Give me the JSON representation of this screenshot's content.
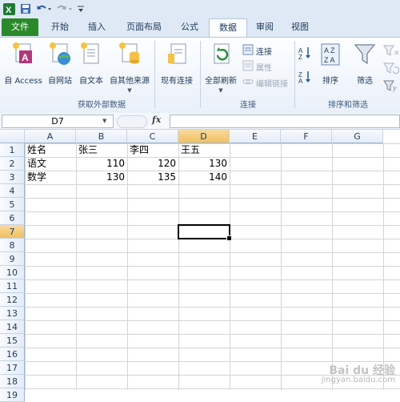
{
  "quick_access": {
    "app_icon": "excel-icon",
    "save_icon": "save-icon",
    "undo_icon": "undo-icon",
    "redo_icon": "redo-icon",
    "customize_icon": "customize-icon"
  },
  "tabs": [
    "文件",
    "开始",
    "插入",
    "页面布局",
    "公式",
    "数据",
    "审阅",
    "视图"
  ],
  "active_tab": "数据",
  "ribbon": {
    "get_external_data": {
      "label": "获取外部数据",
      "buttons": [
        "自 Access",
        "自网站",
        "自文本",
        "自其他来源"
      ]
    },
    "existing_connections": "现有连接",
    "connections": {
      "label": "连接",
      "refresh_all": "全部刷新",
      "connections": "连接",
      "properties": "属性",
      "edit_links": "编辑链接"
    },
    "sort_filter": {
      "label": "排序和筛选",
      "sort": "排序",
      "filter": "筛选"
    }
  },
  "formula_bar": {
    "name_box": "D7",
    "fx": "fx",
    "value": ""
  },
  "sheet": {
    "columns": [
      "A",
      "B",
      "C",
      "D",
      "E",
      "F",
      "G"
    ],
    "selected_column": "D",
    "rows": [
      "1",
      "2",
      "3",
      "4",
      "5",
      "6",
      "7",
      "8",
      "9",
      "10",
      "11",
      "12",
      "13",
      "14",
      "15",
      "16",
      "17",
      "18",
      "19"
    ],
    "selected_row": "7",
    "cells": {
      "A1": "姓名",
      "B1": "张三",
      "C1": "李四",
      "D1": "王五",
      "A2": "语文",
      "B2": "110",
      "C2": "120",
      "D2": "130",
      "A3": "数学",
      "B3": "130",
      "C3": "135",
      "D3": "140"
    },
    "active_cell": "D7"
  },
  "watermark": {
    "line1": "Bai du 经验",
    "line2": "jingyan.baidu.com"
  }
}
